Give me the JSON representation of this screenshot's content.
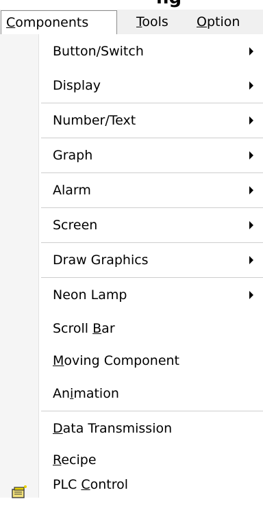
{
  "topstrip": {
    "clipped_text": "ng"
  },
  "menubar": {
    "items": [
      {
        "mnemonic": "C",
        "rest": "omponents"
      },
      {
        "mnemonic": "T",
        "rest": "ools"
      },
      {
        "mnemonic": "O",
        "rest": "ption"
      }
    ]
  },
  "menu": {
    "items": [
      {
        "label": "Button/Switch"
      },
      {
        "label": "Display"
      },
      {
        "label": "Number/Text"
      },
      {
        "label": "Graph"
      },
      {
        "label": "Alarm"
      },
      {
        "label": "Screen"
      },
      {
        "label": "Draw Graphics"
      },
      {
        "label": "Neon Lamp"
      },
      {
        "pre": "Scroll ",
        "mnemonic": "B",
        "post": "ar"
      },
      {
        "pre": "",
        "mnemonic": "M",
        "post": "oving Component"
      },
      {
        "pre": "An",
        "mnemonic": "i",
        "post": "mation"
      },
      {
        "pre": "",
        "mnemonic": "D",
        "post": "ata Transmission"
      },
      {
        "pre": "",
        "mnemonic": "R",
        "post": "ecipe"
      },
      {
        "pre": "PLC ",
        "mnemonic": "C",
        "post": "ontrol",
        "icon": "plc-control-icon"
      }
    ]
  },
  "colors": {
    "menubar_bg": "#f0f0f0",
    "dropdown_bg": "#ffffff",
    "separator": "#cdcdcd",
    "icon_yellow": "#e8d200",
    "icon_dark": "#3a3a3a"
  }
}
